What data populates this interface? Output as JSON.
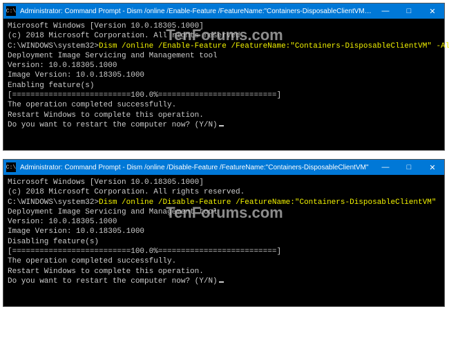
{
  "watermark": "TenForums.com",
  "windows": [
    {
      "title": "Administrator: Command Prompt - Dism  /online /Enable-Feature /FeatureName:\"Containers-DisposableClientVM\" -All",
      "icon_text": "C:\\",
      "min_label": "—",
      "max_label": "□",
      "close_label": "✕",
      "lines": {
        "l0": "Microsoft Windows [Version 10.0.18305.1000]",
        "l1": "(c) 2018 Microsoft Corporation. All rights reserved.",
        "l2": "",
        "prompt": "C:\\WINDOWS\\system32>",
        "cmd": "Dism /online /Enable-Feature /FeatureName:\"Containers-DisposableClientVM\" -All",
        "l3": "",
        "l4": "Deployment Image Servicing and Management tool",
        "l5": "Version: 10.0.18305.1000",
        "l6": "",
        "l7": "Image Version: 10.0.18305.1000",
        "l8": "",
        "l9": "Enabling feature(s)",
        "l10": "[==========================100.0%==========================]",
        "l11": "The operation completed successfully.",
        "l12": "Restart Windows to complete this operation.",
        "l13": "Do you want to restart the computer now? (Y/N)"
      }
    },
    {
      "title": "Administrator: Command Prompt - Dism  /online /Disable-Feature /FeatureName:\"Containers-DisposableClientVM\"",
      "icon_text": "C:\\",
      "min_label": "—",
      "max_label": "□",
      "close_label": "✕",
      "lines": {
        "l0": "Microsoft Windows [Version 10.0.18305.1000]",
        "l1": "(c) 2018 Microsoft Corporation. All rights reserved.",
        "l2": "",
        "prompt": "C:\\WINDOWS\\system32>",
        "cmd": "Dism /online /Disable-Feature /FeatureName:\"Containers-DisposableClientVM\"",
        "l3": "",
        "l4": "Deployment Image Servicing and Management tool",
        "l5": "Version: 10.0.18305.1000",
        "l6": "",
        "l7": "Image Version: 10.0.18305.1000",
        "l8": "",
        "l9": "Disabling feature(s)",
        "l10": "[==========================100.0%==========================]",
        "l11": "The operation completed successfully.",
        "l12": "Restart Windows to complete this operation.",
        "l13": "Do you want to restart the computer now? (Y/N)"
      }
    }
  ]
}
